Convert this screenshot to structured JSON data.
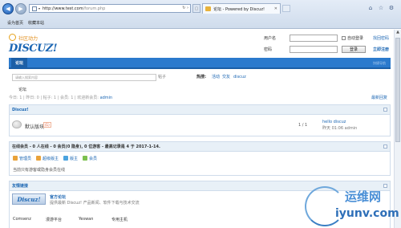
{
  "browser": {
    "url_host": "http://www.test.com",
    "url_path": "/forum.php",
    "tab_title": "论坛 - Powered by Discuz!",
    "favorites": [
      "设为首页",
      "收藏本站"
    ]
  },
  "header": {
    "logo_sub": "社区动力",
    "logo_main": "DISCUZ!",
    "login": {
      "username_label": "用户名",
      "password_label": "密码",
      "auto_login": "自动登录",
      "find_password": "找回密码",
      "login_button": "登录",
      "register": "立即注册"
    }
  },
  "nav": {
    "active_tab": "论坛",
    "right_link": "快捷导航"
  },
  "search": {
    "placeholder": "请输入搜索内容",
    "button": "帖子",
    "hot_label": "热搜:",
    "hot_terms": [
      "活动",
      "交友",
      "discuz"
    ]
  },
  "breadcrumb": "论坛",
  "stats": {
    "text": "今日: 1 | 昨日: 0 | 帖子: 1 | 会员: 1 | 欢迎新会员: ",
    "new_member": "admin",
    "newest_link": "最新回复"
  },
  "category": {
    "title": "Discuz!",
    "forum": {
      "name": "默认版块",
      "today_count": "(1)",
      "count": "1 / 1",
      "last_post_title": "hello discuz",
      "last_post_meta": "昨天 01:06 admin"
    }
  },
  "online": {
    "title": "在线会员 - 0 人在线 - 0 会员(0 隐身), 0 位游客 - 最高记录是 4 于 2017-1-14.",
    "legend": [
      {
        "label": "管理员",
        "color": "#e9a23a"
      },
      {
        "label": "超级版主",
        "color": "#e9a23a"
      },
      {
        "label": "版主",
        "color": "#4aa3df"
      },
      {
        "label": "会员",
        "color": "#7cc04f"
      }
    ],
    "none_text": "当前只有游客或隐身会员在线"
  },
  "links": {
    "title": "友情链接",
    "banner_text": "Discuz!",
    "official_name": "官方论坛",
    "official_desc": "提供最新 Discuz! 产品新闻、软件下载与技术交流",
    "sub_links": [
      "Comsenz",
      "漫游平台",
      "Yeswan",
      "专用主机"
    ]
  },
  "watermark": {
    "cn": "运维网",
    "en": "iyunv.com"
  }
}
